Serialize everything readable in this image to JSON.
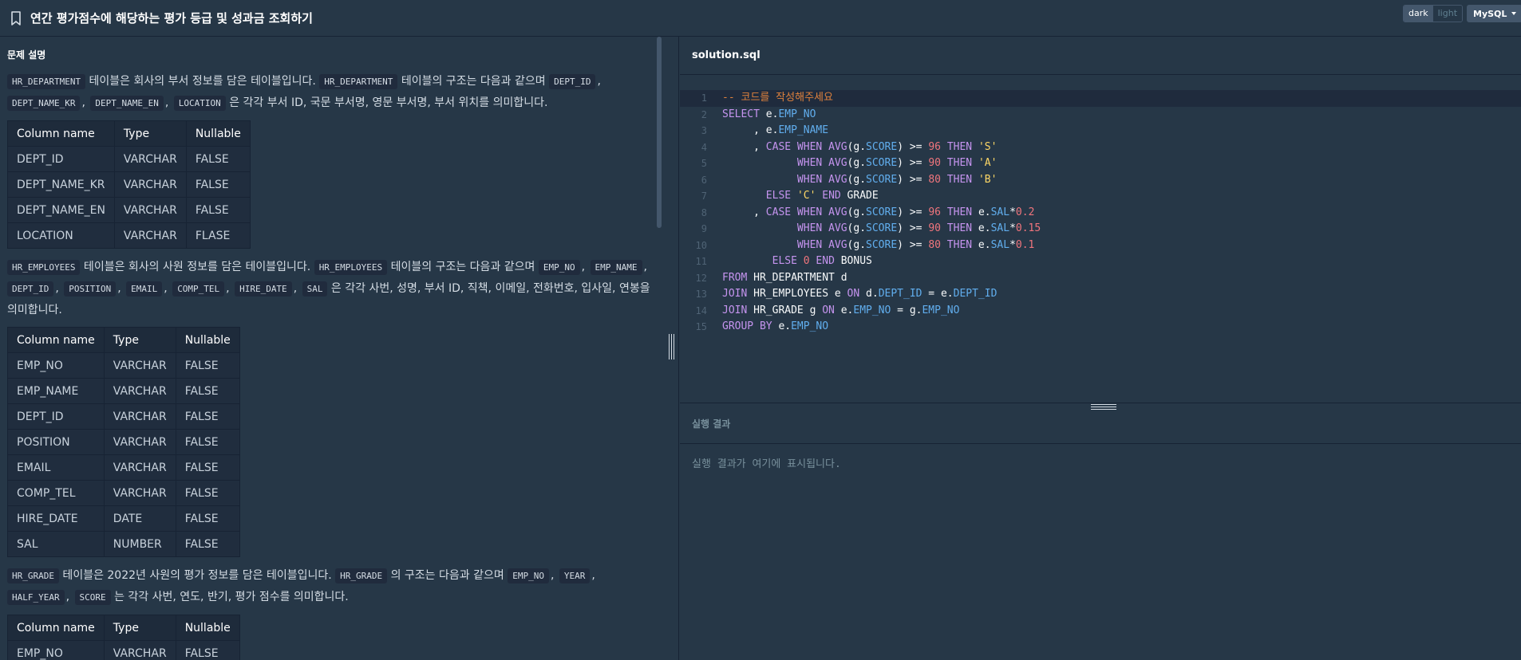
{
  "header": {
    "title": "연간 평가점수에 해당하는 평가 등급 및 성과금 조회하기",
    "theme_dark": "dark",
    "theme_light": "light",
    "db": "MySQL"
  },
  "problem": {
    "section_title": "문제 설명",
    "para1": {
      "code1": "HR_DEPARTMENT",
      "text1": " 테이블은 회사의 부서 정보를 담은 테이블입니다. ",
      "code2": "HR_DEPARTMENT",
      "text2": " 테이블의 구조는 다음과 같으며 ",
      "code3": "DEPT_ID",
      "code4": "DEPT_NAME_KR",
      "code5": "DEPT_NAME_EN",
      "code6": "LOCATION",
      "text3": " 은 각각 부서 ID, 국문 부서명, 영문 부서명, 부서 위치를 의미합니다."
    },
    "table_headers": [
      "Column name",
      "Type",
      "Nullable"
    ],
    "table1": [
      [
        "DEPT_ID",
        "VARCHAR",
        "FALSE"
      ],
      [
        "DEPT_NAME_KR",
        "VARCHAR",
        "FALSE"
      ],
      [
        "DEPT_NAME_EN",
        "VARCHAR",
        "FALSE"
      ],
      [
        "LOCATION",
        "VARCHAR",
        "FLASE"
      ]
    ],
    "para2": {
      "code1": "HR_EMPLOYEES",
      "text1": " 테이블은 회사의 사원 정보를 담은 테이블입니다. ",
      "code2": "HR_EMPLOYEES",
      "text2": " 테이블의 구조는 다음과 같으며 ",
      "code3": "EMP_NO",
      "code4": "EMP_NAME",
      "code5": "DEPT_ID",
      "code6": "POSITION",
      "code7": "EMAIL",
      "code8": "COMP_TEL",
      "code9": "HIRE_DATE",
      "code10": "SAL",
      "text3": " 은 각각 사번, 성명, 부서 ID, 직책, 이메일, 전화번호, 입사일, 연봉을 의미합니다."
    },
    "table2": [
      [
        "EMP_NO",
        "VARCHAR",
        "FALSE"
      ],
      [
        "EMP_NAME",
        "VARCHAR",
        "FALSE"
      ],
      [
        "DEPT_ID",
        "VARCHAR",
        "FALSE"
      ],
      [
        "POSITION",
        "VARCHAR",
        "FALSE"
      ],
      [
        "EMAIL",
        "VARCHAR",
        "FALSE"
      ],
      [
        "COMP_TEL",
        "VARCHAR",
        "FALSE"
      ],
      [
        "HIRE_DATE",
        "DATE",
        "FALSE"
      ],
      [
        "SAL",
        "NUMBER",
        "FALSE"
      ]
    ],
    "para3": {
      "code1": "HR_GRADE",
      "text1": " 테이블은 2022년 사원의 평가 정보를 담은 테이블입니다. ",
      "code2": "HR_GRADE",
      "text2": " 의 구조는 다음과 같으며 ",
      "code3": "EMP_NO",
      "code4": "YEAR",
      "code5": "HALF_YEAR",
      "code6": "SCORE",
      "text3": " 는 각각 사번, 연도, 반기, 평가 점수를 의미합니다."
    },
    "table3": [
      [
        "EMP_NO",
        "VARCHAR",
        "FALSE"
      ]
    ]
  },
  "editor": {
    "tab_label": "solution.sql",
    "lines": [
      [
        [
          "cm",
          "-- 코드를 작성해주세요"
        ]
      ],
      [
        [
          "kw",
          "SELECT"
        ],
        [
          "op",
          " e."
        ],
        [
          "col",
          "EMP_NO"
        ]
      ],
      [
        [
          "op",
          "     , e."
        ],
        [
          "col",
          "EMP_NAME"
        ]
      ],
      [
        [
          "op",
          "     , "
        ],
        [
          "kw",
          "CASE WHEN"
        ],
        [
          "op",
          " "
        ],
        [
          "fn",
          "AVG"
        ],
        [
          "op",
          "(g."
        ],
        [
          "col",
          "SCORE"
        ],
        [
          "op",
          ") >= "
        ],
        [
          "num",
          "96"
        ],
        [
          "op",
          " "
        ],
        [
          "kw",
          "THEN"
        ],
        [
          "op",
          " "
        ],
        [
          "str",
          "'S'"
        ]
      ],
      [
        [
          "op",
          "            "
        ],
        [
          "kw",
          "WHEN"
        ],
        [
          "op",
          " "
        ],
        [
          "fn",
          "AVG"
        ],
        [
          "op",
          "(g."
        ],
        [
          "col",
          "SCORE"
        ],
        [
          "op",
          ") >= "
        ],
        [
          "num",
          "90"
        ],
        [
          "op",
          " "
        ],
        [
          "kw",
          "THEN"
        ],
        [
          "op",
          " "
        ],
        [
          "str",
          "'A'"
        ]
      ],
      [
        [
          "op",
          "            "
        ],
        [
          "kw",
          "WHEN"
        ],
        [
          "op",
          " "
        ],
        [
          "fn",
          "AVG"
        ],
        [
          "op",
          "(g."
        ],
        [
          "col",
          "SCORE"
        ],
        [
          "op",
          ") >= "
        ],
        [
          "num",
          "80"
        ],
        [
          "op",
          " "
        ],
        [
          "kw",
          "THEN"
        ],
        [
          "op",
          " "
        ],
        [
          "str",
          "'B'"
        ]
      ],
      [
        [
          "op",
          "       "
        ],
        [
          "kw",
          "ELSE"
        ],
        [
          "op",
          " "
        ],
        [
          "str",
          "'C'"
        ],
        [
          "op",
          " "
        ],
        [
          "kw",
          "END"
        ],
        [
          "op",
          " GRADE"
        ]
      ],
      [
        [
          "op",
          "     , "
        ],
        [
          "kw",
          "CASE WHEN"
        ],
        [
          "op",
          " "
        ],
        [
          "fn",
          "AVG"
        ],
        [
          "op",
          "(g."
        ],
        [
          "col",
          "SCORE"
        ],
        [
          "op",
          ") >= "
        ],
        [
          "num",
          "96"
        ],
        [
          "op",
          " "
        ],
        [
          "kw",
          "THEN"
        ],
        [
          "op",
          " e."
        ],
        [
          "col",
          "SAL"
        ],
        [
          "op",
          "*"
        ],
        [
          "num",
          "0.2"
        ]
      ],
      [
        [
          "op",
          "            "
        ],
        [
          "kw",
          "WHEN"
        ],
        [
          "op",
          " "
        ],
        [
          "fn",
          "AVG"
        ],
        [
          "op",
          "(g."
        ],
        [
          "col",
          "SCORE"
        ],
        [
          "op",
          ") >= "
        ],
        [
          "num",
          "90"
        ],
        [
          "op",
          " "
        ],
        [
          "kw",
          "THEN"
        ],
        [
          "op",
          " e."
        ],
        [
          "col",
          "SAL"
        ],
        [
          "op",
          "*"
        ],
        [
          "num",
          "0.15"
        ]
      ],
      [
        [
          "op",
          "            "
        ],
        [
          "kw",
          "WHEN"
        ],
        [
          "op",
          " "
        ],
        [
          "fn",
          "AVG"
        ],
        [
          "op",
          "(g."
        ],
        [
          "col",
          "SCORE"
        ],
        [
          "op",
          ") >= "
        ],
        [
          "num",
          "80"
        ],
        [
          "op",
          " "
        ],
        [
          "kw",
          "THEN"
        ],
        [
          "op",
          " e."
        ],
        [
          "col",
          "SAL"
        ],
        [
          "op",
          "*"
        ],
        [
          "num",
          "0.1"
        ]
      ],
      [
        [
          "op",
          "        "
        ],
        [
          "kw",
          "ELSE"
        ],
        [
          "op",
          " "
        ],
        [
          "num",
          "0"
        ],
        [
          "op",
          " "
        ],
        [
          "kw",
          "END"
        ],
        [
          "op",
          " BONUS"
        ]
      ],
      [
        [
          "kw",
          "FROM"
        ],
        [
          "op",
          " HR_DEPARTMENT d"
        ]
      ],
      [
        [
          "kw",
          "JOIN"
        ],
        [
          "op",
          " HR_EMPLOYEES e "
        ],
        [
          "kw",
          "ON"
        ],
        [
          "op",
          " d."
        ],
        [
          "col",
          "DEPT_ID"
        ],
        [
          "op",
          " = e."
        ],
        [
          "col",
          "DEPT_ID"
        ]
      ],
      [
        [
          "kw",
          "JOIN"
        ],
        [
          "op",
          " HR_GRADE g "
        ],
        [
          "kw",
          "ON"
        ],
        [
          "op",
          " e."
        ],
        [
          "col",
          "EMP_NO"
        ],
        [
          "op",
          " = g."
        ],
        [
          "col",
          "EMP_NO"
        ]
      ],
      [
        [
          "kw",
          "GROUP BY"
        ],
        [
          "op",
          " e."
        ],
        [
          "col",
          "EMP_NO"
        ]
      ]
    ]
  },
  "result": {
    "title": "실행 결과",
    "placeholder": "실행 결과가 여기에 표시됩니다."
  }
}
